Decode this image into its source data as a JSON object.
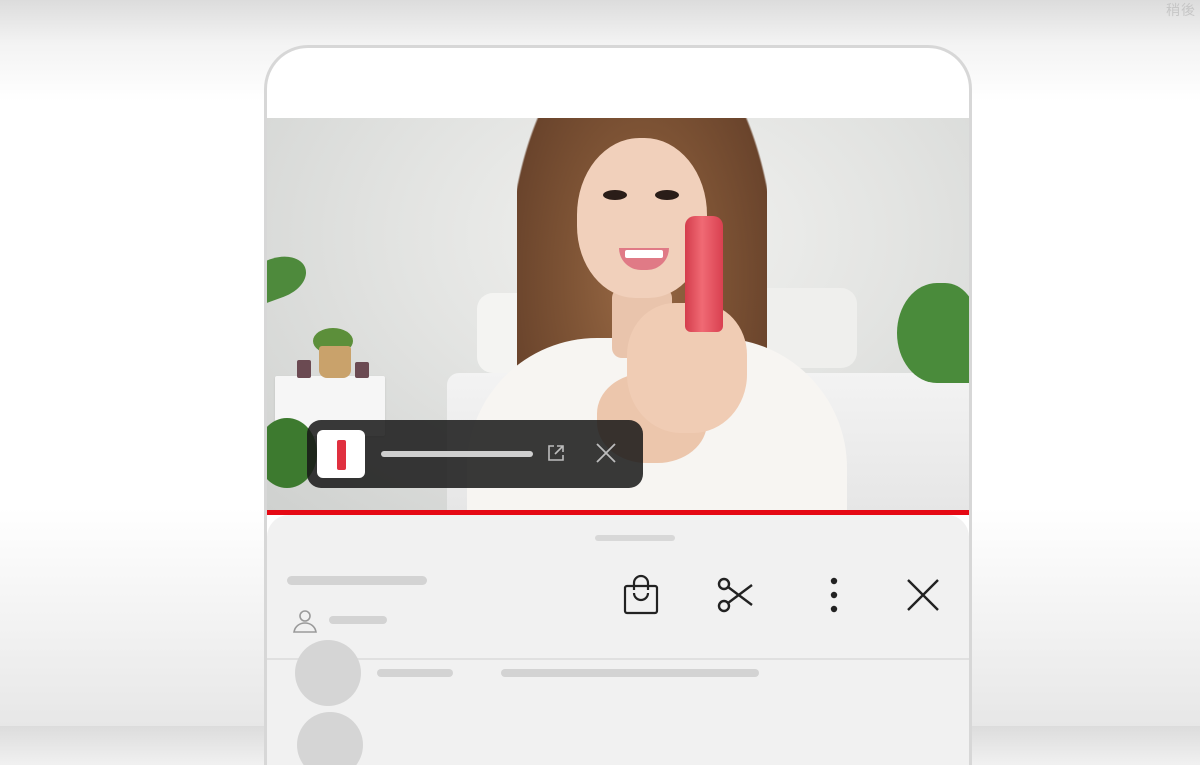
{
  "corner": {
    "text": "稍後"
  },
  "video": {
    "description_label": "",
    "progress_fraction": 1.0,
    "progress_color": "#e50914"
  },
  "product_overlay": {
    "thumb_icon": "lipstick-thumbnail",
    "actions": [
      "open-external-icon",
      "close-icon"
    ]
  },
  "panel": {
    "actions": [
      "shopping-bag-icon",
      "scissors-icon",
      "more-vertical-icon",
      "close-icon"
    ],
    "icon_color": "#222222"
  }
}
